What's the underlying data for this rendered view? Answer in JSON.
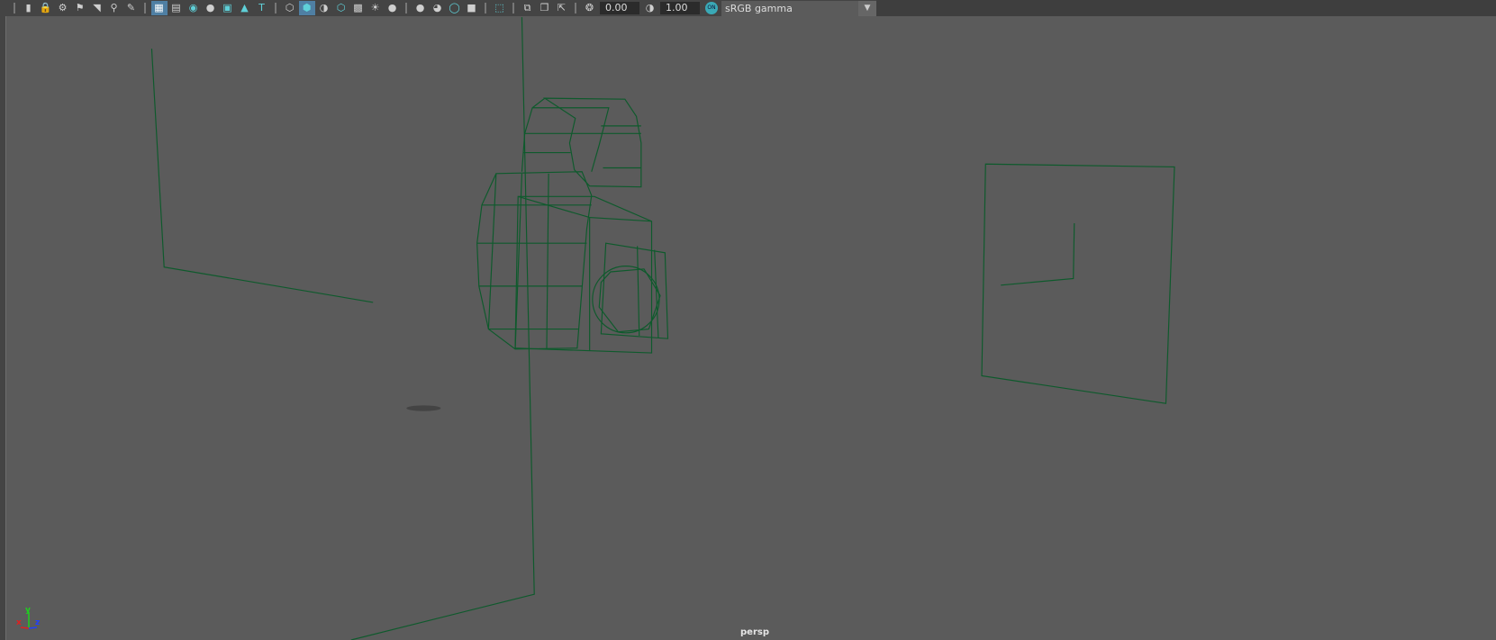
{
  "toolbar": {
    "camera_icons": [
      "select-camera-icon",
      "lock-camera-icon",
      "camera-attributes-icon",
      "bookmarks-icon",
      "image-plane-icon",
      "pan-zoom-icon",
      "grease-pencil-icon"
    ],
    "display_icons": [
      "grid-icon",
      "film-gate-icon",
      "resolution-gate-icon",
      "gate-mask-icon",
      "field-chart-icon",
      "safe-action-icon",
      "safe-title-icon"
    ],
    "shading_icons": [
      "wireframe-icon",
      "smooth-shade-icon",
      "default-material-icon",
      "wireframe-on-shaded-icon",
      "xray-icon",
      "use-all-lights-icon",
      "shadows-icon"
    ],
    "render_icons": [
      "ambient-occlusion-icon",
      "motion-blur-icon",
      "anti-aliasing-icon",
      "depth-of-field-icon"
    ],
    "isolate_icon": "isolate-select-icon",
    "xray_icons": [
      "xray-joints-icon",
      "xray-active-icon",
      "textured-icon"
    ],
    "exposure": "0.00",
    "gamma": "1.00",
    "color_management": "ON",
    "view_transform": "sRGB gamma",
    "active_color": "#4f7fa3"
  },
  "viewport": {
    "camera": "persp",
    "axis": {
      "x": "x",
      "y": "y",
      "z": "z"
    },
    "wireframe_color": "#0e5a2c",
    "background": "#5b5b5b"
  }
}
